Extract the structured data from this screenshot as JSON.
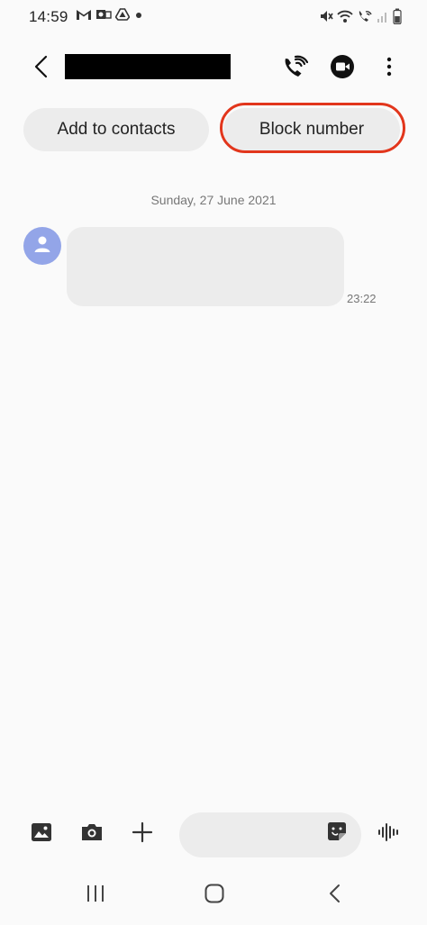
{
  "status_bar": {
    "time": "14:59",
    "left_icons": [
      "gmail-icon",
      "outlook-icon",
      "drive-icon",
      "notification-dot-icon"
    ],
    "right_icons": [
      "mute-icon",
      "wifi-icon",
      "wifi-calling-icon",
      "signal-icon",
      "battery-icon"
    ]
  },
  "app_bar": {
    "back_icon": "chevron-left-icon",
    "contact_name": "",
    "call_icon": "wifi-call-icon",
    "video_icon": "video-call-icon",
    "more_icon": "more-vertical-icon"
  },
  "actions": {
    "add_to_contacts": "Add to contacts",
    "block_number": "Block number"
  },
  "conversation": {
    "date": "Sunday, 27 June 2021",
    "messages": [
      {
        "sender": "contact",
        "text": "",
        "time": "23:22"
      }
    ]
  },
  "composer": {
    "gallery_icon": "gallery-icon",
    "camera_icon": "camera-icon",
    "add_icon": "plus-icon",
    "message_value": "",
    "sticker_icon": "sticker-icon",
    "voice_icon": "voice-waveform-icon"
  },
  "nav_bar": [
    "recents-icon",
    "home-icon",
    "back-icon"
  ],
  "colors": {
    "background": "#fafafa",
    "pill": "#ececec",
    "highlight": "#e2361c",
    "avatar": "#93a5e8"
  }
}
